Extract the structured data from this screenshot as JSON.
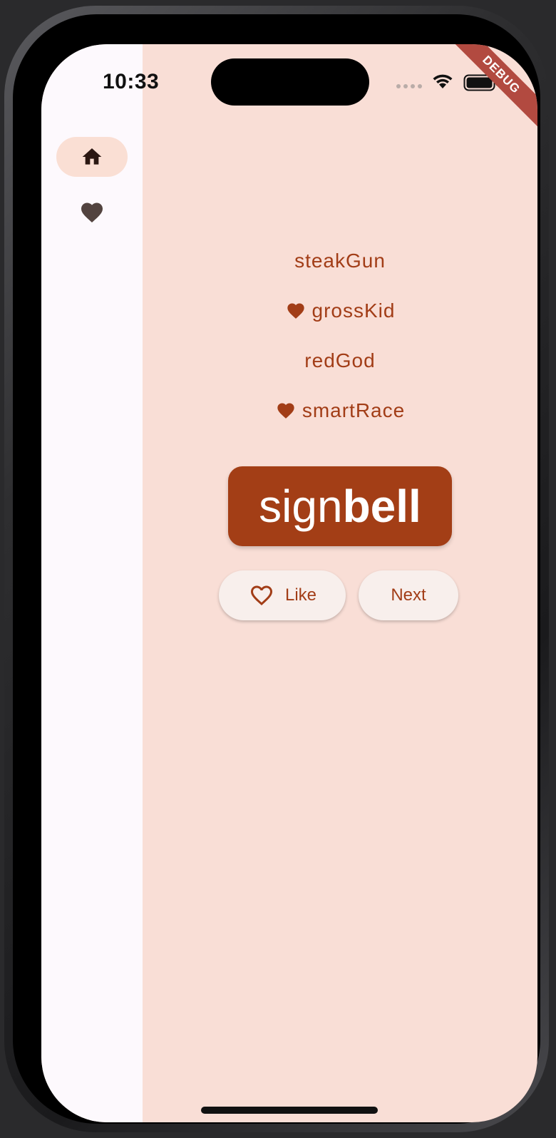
{
  "status_bar": {
    "time": "10:33",
    "icons": [
      "signal-icon",
      "wifi-icon",
      "battery-icon"
    ]
  },
  "debug_banner": "DEBUG",
  "nav_rail": {
    "items": [
      {
        "icon": "home-icon",
        "selected": true
      },
      {
        "icon": "heart-icon",
        "selected": false
      }
    ]
  },
  "history": [
    {
      "word": "steakGun",
      "favorite": false
    },
    {
      "word": "grossKid",
      "favorite": true
    },
    {
      "word": "redGod",
      "favorite": false
    },
    {
      "word": "smartRace",
      "favorite": true
    }
  ],
  "current_pair": {
    "first": "sign",
    "second": "bell"
  },
  "buttons": {
    "like_label": "Like",
    "next_label": "Next"
  },
  "colors": {
    "primary": "#a33e16",
    "background": "#f9ded6",
    "rail_background": "#fdf9fd",
    "rail_selected": "#fadfd4"
  }
}
